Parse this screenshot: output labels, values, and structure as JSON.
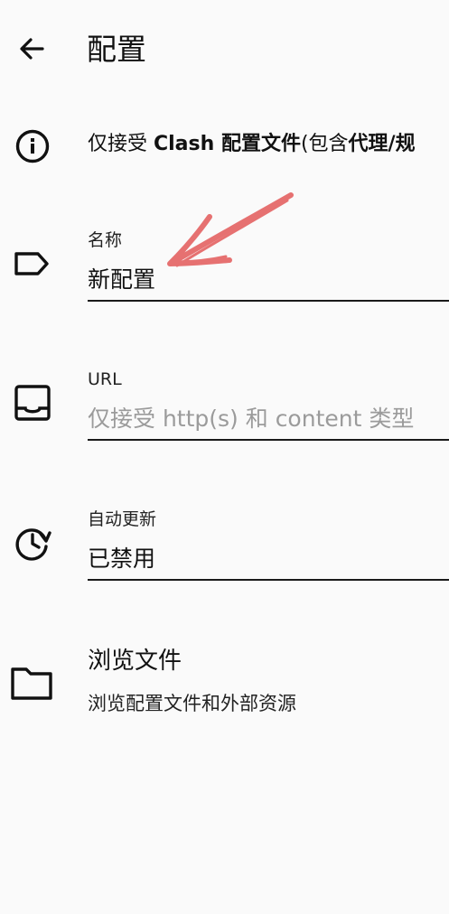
{
  "appbar": {
    "title": "配置"
  },
  "info": {
    "prefix": "仅接受 ",
    "bold1": "Clash 配置文件",
    "mid": "(包含",
    "bold2": "代理/规"
  },
  "fields": {
    "name": {
      "label": "名称",
      "value": "新配置"
    },
    "url": {
      "label": "URL",
      "placeholder": "仅接受 http(s) 和 content 类型"
    },
    "auto_update": {
      "label": "自动更新",
      "value": "已禁用"
    }
  },
  "browse": {
    "title": "浏览文件",
    "subtitle": "浏览配置文件和外部资源"
  },
  "colors": {
    "background": "#fafafa",
    "text": "#111111",
    "placeholder": "#9b9b9b",
    "annotation_arrow": "#e35a5a"
  },
  "icons": {
    "back": "arrow-left-icon",
    "info": "info-circle-icon",
    "name": "label-tag-icon",
    "url": "inbox-tray-icon",
    "auto_update": "history-clock-icon",
    "browse": "folder-icon"
  }
}
